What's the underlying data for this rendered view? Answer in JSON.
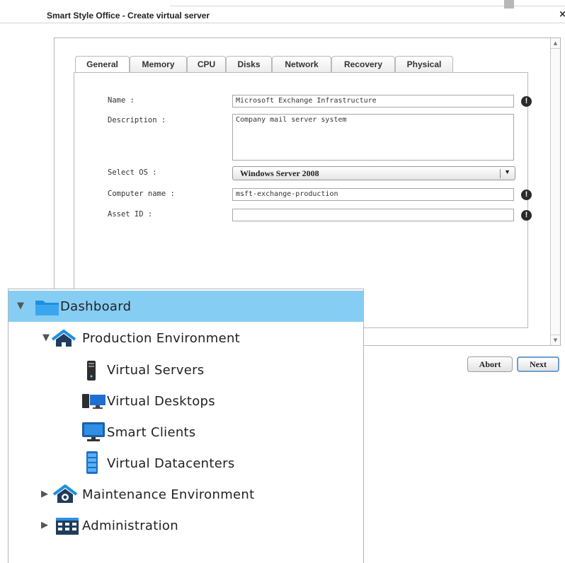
{
  "window": {
    "title": "Smart Style Office - Create virtual server",
    "close_glyph": "×"
  },
  "tabs": [
    {
      "label": "General",
      "active": true
    },
    {
      "label": "Memory"
    },
    {
      "label": "CPU"
    },
    {
      "label": "Disks"
    },
    {
      "label": "Network"
    },
    {
      "label": "Recovery"
    },
    {
      "label": "Physical"
    }
  ],
  "form": {
    "name": {
      "label": "Name :",
      "value": "Microsoft Exchange Infrastructure"
    },
    "description": {
      "label": "Description :",
      "value": "Company mail server system"
    },
    "os": {
      "label": "Select OS :",
      "value": "Windows Server 2008"
    },
    "computer_name": {
      "label": "Computer name :",
      "value": "msft-exchange-production"
    },
    "asset_id": {
      "label": "Asset ID :",
      "value": ""
    },
    "warn_glyph": "!"
  },
  "buttons": {
    "abort": "Abort",
    "next": "Next"
  },
  "tree": {
    "items": [
      {
        "label": "Dashboard",
        "icon": "folder-icon",
        "expanded": true,
        "selected": true
      },
      {
        "label": "Production Environment",
        "icon": "home-icon",
        "expanded": true
      },
      {
        "label": "Virtual Servers",
        "icon": "server-tower-icon"
      },
      {
        "label": "Virtual Desktops",
        "icon": "desktop-icon"
      },
      {
        "label": "Smart Clients",
        "icon": "monitor-icon"
      },
      {
        "label": "Virtual Datacenters",
        "icon": "datacenter-icon"
      },
      {
        "label": "Maintenance Environment",
        "icon": "home-gear-icon",
        "expanded": false
      },
      {
        "label": "Administration",
        "icon": "admin-grid-icon",
        "expanded": false
      }
    ]
  },
  "colors": {
    "tree_selected": "#86cdf4",
    "folder_blue": "#1e8fe0",
    "button_focus": "#6a9fce"
  }
}
